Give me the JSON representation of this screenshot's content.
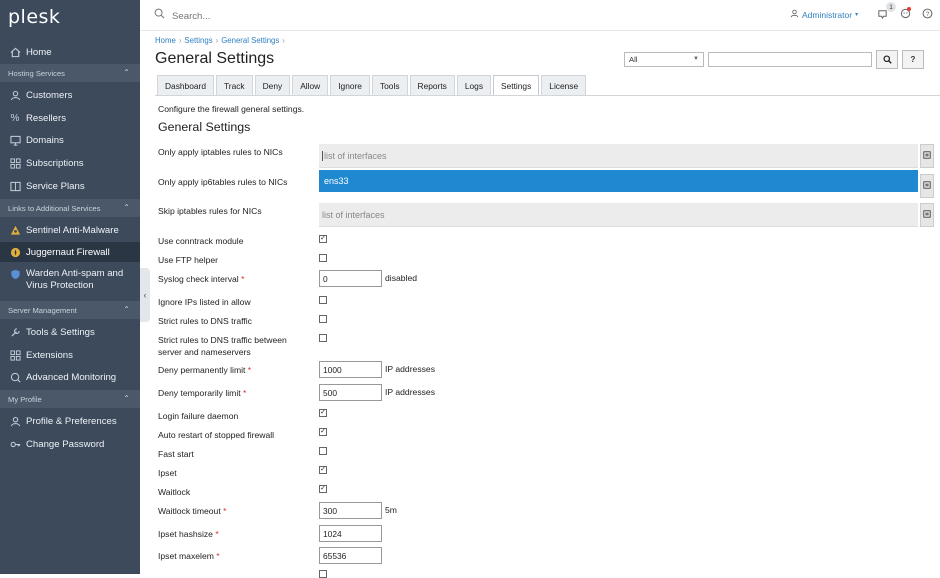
{
  "sidebar": {
    "logo": "plesk",
    "home": "Home",
    "sections": {
      "hosting": "Hosting Services",
      "links": "Links to Additional Services",
      "server": "Server Management",
      "profile": "My Profile"
    },
    "items": {
      "customers": "Customers",
      "resellers": "Resellers",
      "domains": "Domains",
      "subscriptions": "Subscriptions",
      "service_plans": "Service Plans",
      "sentinel": "Sentinel Anti-Malware",
      "juggernaut": "Juggernaut Firewall",
      "warden_1": "Warden Anti-spam and",
      "warden_2": "Virus Protection",
      "tools": "Tools & Settings",
      "extensions": "Extensions",
      "monitoring": "Advanced Monitoring",
      "profile_prefs": "Profile & Preferences",
      "change_password": "Change Password"
    }
  },
  "topbar": {
    "search_placeholder": "Search...",
    "user": "Administrator",
    "notification_count": "1"
  },
  "breadcrumb": [
    "Home",
    "Settings",
    "General Settings"
  ],
  "page_title": "General Settings",
  "filter": {
    "select_value": "All",
    "search_button": "🔍",
    "help_button": "?"
  },
  "tabs": [
    "Dashboard",
    "Track",
    "Deny",
    "Allow",
    "Ignore",
    "Tools",
    "Reports",
    "Logs",
    "Settings",
    "License"
  ],
  "active_tab": "Settings",
  "intro": "Configure the firewall general settings.",
  "section_title": "General Settings",
  "settings": {
    "iptables_nics_label": "Only apply iptables rules to NICs",
    "iptables_nics_placeholder": "list of interfaces",
    "ip6tables_nics_label": "Only apply ip6tables rules to NICs",
    "ip6tables_nics_value": "ens33",
    "skip_nics_label": "Skip iptables rules for NICs",
    "skip_nics_placeholder": "list of interfaces",
    "conntrack_label": "Use conntrack module",
    "conntrack_checked": true,
    "ftp_helper_label": "Use FTP helper",
    "ftp_helper_checked": false,
    "syslog_label": "Syslog check interval",
    "syslog_value": "0",
    "syslog_unit": "disabled",
    "ignore_ips_label": "Ignore IPs listed in allow",
    "ignore_ips_checked": false,
    "strict_dns_label": "Strict rules to DNS traffic",
    "strict_dns_checked": false,
    "strict_dns_ns_label_1": "Strict rules to DNS traffic between",
    "strict_dns_ns_label_2": "server and nameservers",
    "strict_dns_ns_checked": false,
    "deny_perm_label": "Deny permanently limit",
    "deny_perm_value": "1000",
    "deny_perm_unit": "IP addresses",
    "deny_temp_label": "Deny temporarily limit",
    "deny_temp_value": "500",
    "deny_temp_unit": "IP addresses",
    "login_daemon_label": "Login failure daemon",
    "login_daemon_checked": true,
    "auto_restart_label": "Auto restart of stopped firewall",
    "auto_restart_checked": true,
    "fast_start_label": "Fast start",
    "fast_start_checked": false,
    "ipset_label": "Ipset",
    "ipset_checked": true,
    "waitlock_label": "Waitlock",
    "waitlock_checked": true,
    "waitlock_timeout_label": "Waitlock timeout",
    "waitlock_timeout_value": "300",
    "waitlock_timeout_unit": "5m",
    "ipset_hashsize_label": "Ipset hashsize",
    "ipset_hashsize_value": "1024",
    "ipset_maxelem_label": "Ipset maxelem",
    "ipset_maxelem_value": "65536",
    "required_mark": "*",
    "check_mark": "✓"
  }
}
